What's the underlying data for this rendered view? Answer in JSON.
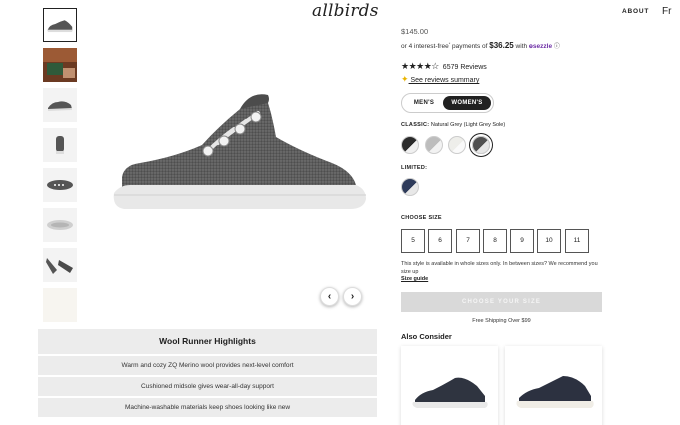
{
  "header": {
    "logo": "allbirds",
    "nav": [
      "ABOUT",
      "Fr"
    ]
  },
  "thumbnails": [
    "shoe-side",
    "lifestyle-photo",
    "shoe-angle",
    "shoe-back",
    "shoe-top",
    "shoe-bottom",
    "shoe-pair",
    "blank"
  ],
  "carousel": {
    "prev": "‹",
    "next": "›"
  },
  "highlights": {
    "title": "Wool Runner Highlights",
    "items": [
      "Warm and cozy ZQ Merino wool provides next-level comfort",
      "Cushioned midsole gives wear-all-day support",
      "Machine-washable materials keep shoes looking like new"
    ]
  },
  "product": {
    "price": "$145.00",
    "installments_prefix": "or 4 interest-free",
    "installments_mid": " payments of ",
    "installment_amount": "$36.25",
    "installments_with": " with ",
    "sezzle": "sezzle",
    "stars": "★★★★☆",
    "review_count": "6579 Reviews",
    "reviews_summary": "See reviews summary",
    "gender": {
      "men": "MEN'S",
      "women": "WOMEN'S",
      "selected": "WOMEN'S"
    },
    "classic_label": "CLASSIC:",
    "classic_color": "Natural Grey (Light Grey Sole)",
    "limited_label": "LIMITED:",
    "size_label": "CHOOSE SIZE",
    "sizes": [
      "5",
      "6",
      "7",
      "8",
      "9",
      "10",
      "11"
    ],
    "size_note": "This style is available in whole sizes only. In between sizes? We recommend you size up",
    "size_guide": "Size guide",
    "cta": "CHOOSE YOUR SIZE",
    "shipping": "Free Shipping Over $99",
    "also_consider": "Also Consider"
  },
  "colors": {
    "text": "#212121",
    "sezzle": "#6d2ea6",
    "cta_bg": "#d9d9d9",
    "panel_bg": "#ececec"
  }
}
